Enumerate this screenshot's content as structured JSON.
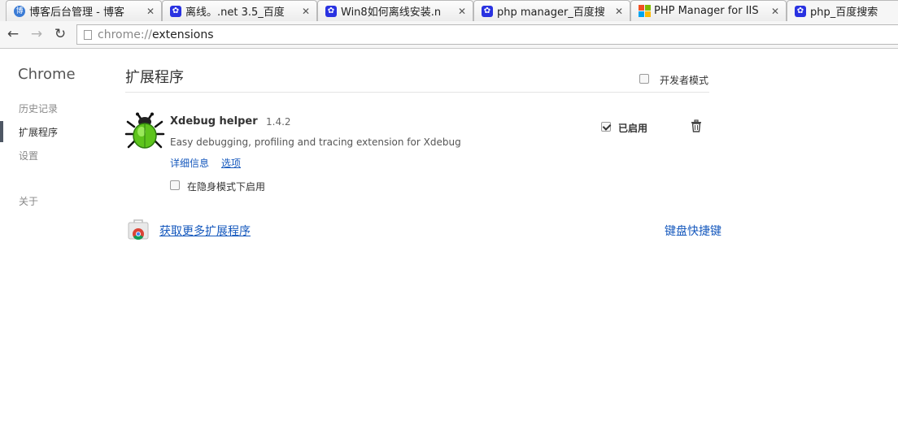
{
  "tabs": [
    {
      "title": "博客后台管理 - 博客",
      "icon": "cnblogs-icon"
    },
    {
      "title": "离线。.net 3.5_百度",
      "icon": "baidu-paw-icon"
    },
    {
      "title": "Win8如何离线安装.n",
      "icon": "baidu-paw-icon"
    },
    {
      "title": "php manager_百度搜",
      "icon": "baidu-paw-icon"
    },
    {
      "title": "PHP Manager for IIS",
      "icon": "microsoft-icon"
    },
    {
      "title": "php_百度搜索",
      "icon": "baidu-paw-icon",
      "active": true
    }
  ],
  "address": {
    "scheme": "chrome://",
    "path": "extensions"
  },
  "sidebar": {
    "brand": "Chrome",
    "items": [
      {
        "label": "历史记录"
      },
      {
        "label": "扩展程序",
        "selected": true
      },
      {
        "label": "设置"
      },
      {
        "label": "关于"
      }
    ]
  },
  "main": {
    "title": "扩展程序",
    "developer_mode_label": "开发者模式",
    "developer_mode_checked": false
  },
  "extension": {
    "name": "Xdebug helper",
    "version": "1.4.2",
    "description": "Easy debugging, profiling and tracing extension for Xdebug",
    "details_link": "详细信息",
    "options_link": "选项",
    "incognito_label": "在隐身模式下启用",
    "incognito_checked": false,
    "enabled_label": "已启用",
    "enabled_checked": true,
    "icon": "bug-icon",
    "accent_color": "#6ccf1f"
  },
  "footer": {
    "get_more_link": "获取更多扩展程序",
    "keyboard_shortcuts_link": "键盘快捷键"
  },
  "colors": {
    "link": "#1558bd"
  }
}
